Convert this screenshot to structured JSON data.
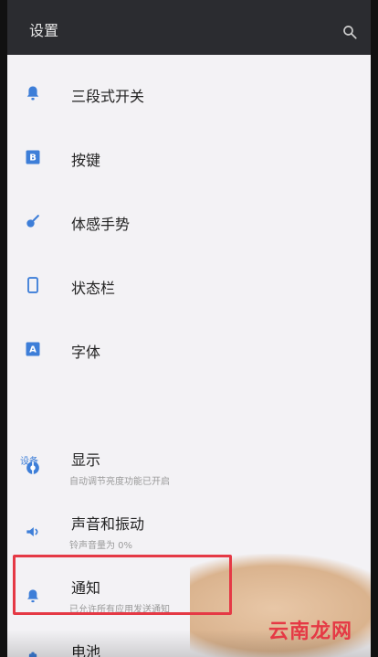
{
  "app": {
    "title": "设置"
  },
  "items": [
    {
      "label": "三段式开关",
      "icon": "bell-icon"
    },
    {
      "label": "按键",
      "icon": "b-icon"
    },
    {
      "label": "体感手势",
      "icon": "gesture-icon"
    },
    {
      "label": "状态栏",
      "icon": "phone-icon"
    },
    {
      "label": "字体",
      "icon": "a-icon"
    }
  ],
  "section": {
    "title": "设备"
  },
  "device_items": [
    {
      "label": "显示",
      "sub": "自动调节亮度功能已开启",
      "icon": "display-icon"
    },
    {
      "label": "声音和振动",
      "sub": "铃声音量为 0%",
      "icon": "volume-icon"
    },
    {
      "label": "通知",
      "sub": "已允许所有应用发送通知",
      "icon": "notification-icon"
    },
    {
      "label": "电池",
      "sub": "",
      "icon": "battery-icon"
    }
  ],
  "watermark": "云南龙网",
  "colors": {
    "topbar": "#2b2c30",
    "accent": "#3d7ed8",
    "highlight": "#e53945",
    "background": "#f3f2f5"
  }
}
